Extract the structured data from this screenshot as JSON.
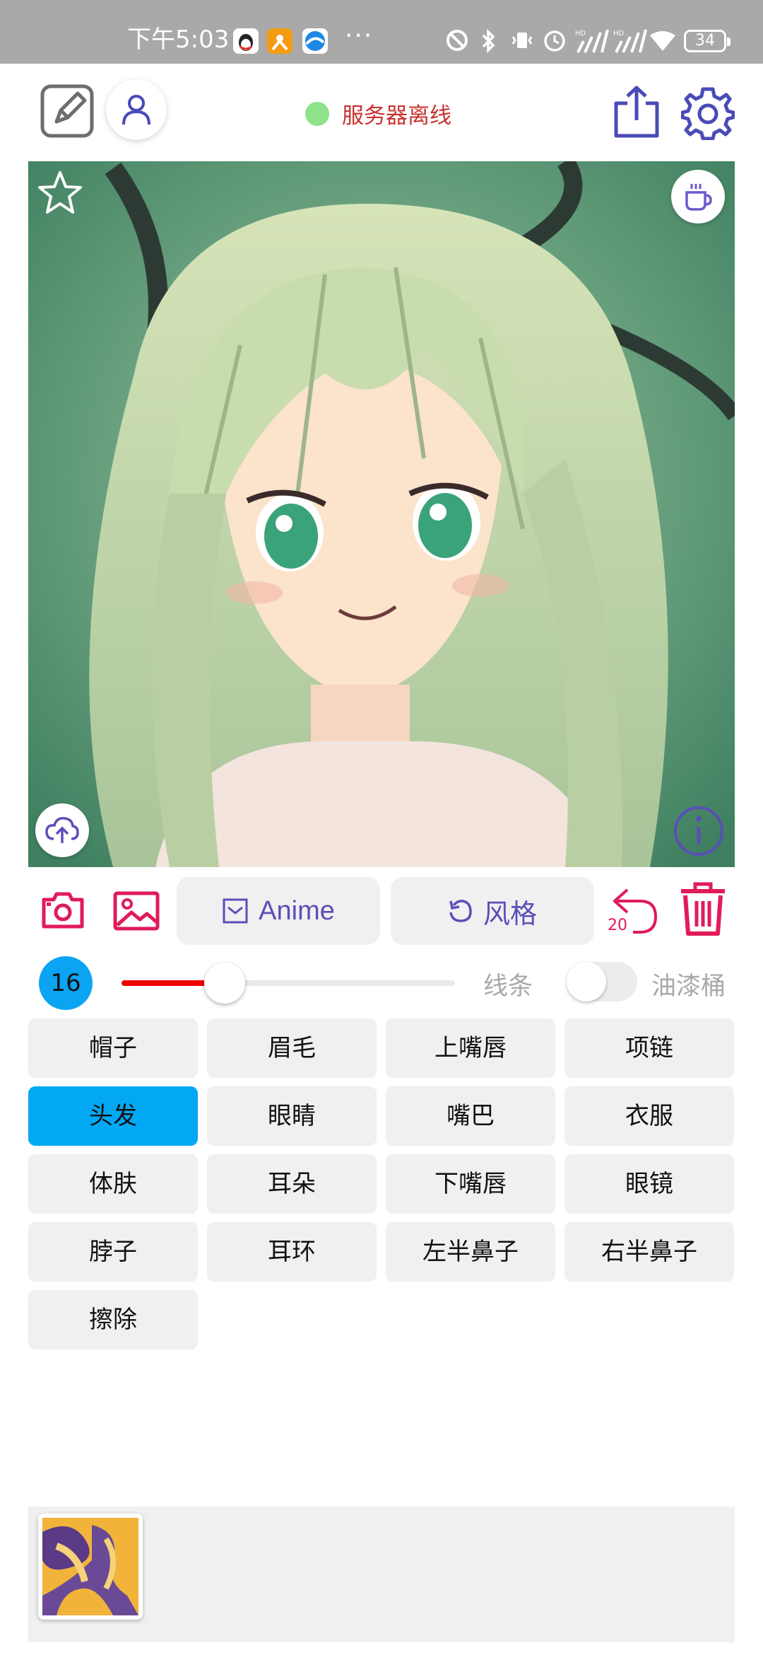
{
  "status_bar": {
    "time": "下午5:03",
    "battery": "34"
  },
  "top_bar": {
    "server_status": "服务器离线",
    "server_status_color": "#8ee28a"
  },
  "toolbar": {
    "anime_label": "Anime",
    "style_label": "风格",
    "undo_count": "20"
  },
  "brush": {
    "size": "16",
    "slider_fraction": 0.31,
    "line_label": "线条",
    "paint_bucket_label": "油漆桶",
    "paint_bucket_on": false
  },
  "parts": [
    {
      "label": "帽子"
    },
    {
      "label": "眉毛"
    },
    {
      "label": "上嘴唇"
    },
    {
      "label": "项链"
    },
    {
      "label": "头发",
      "selected": true
    },
    {
      "label": "眼睛"
    },
    {
      "label": "嘴巴"
    },
    {
      "label": "衣服"
    },
    {
      "label": "体肤"
    },
    {
      "label": "耳朵"
    },
    {
      "label": "下嘴唇"
    },
    {
      "label": "眼镜"
    },
    {
      "label": "脖子"
    },
    {
      "label": "耳环"
    },
    {
      "label": "左半鼻子"
    },
    {
      "label": "右半鼻子"
    },
    {
      "label": "擦除"
    }
  ],
  "colors": {
    "accent_blue": "#02a8f4",
    "accent_pink": "#e01b59",
    "icon_purple": "#5a4fb8",
    "slider_red": "#f00000"
  }
}
